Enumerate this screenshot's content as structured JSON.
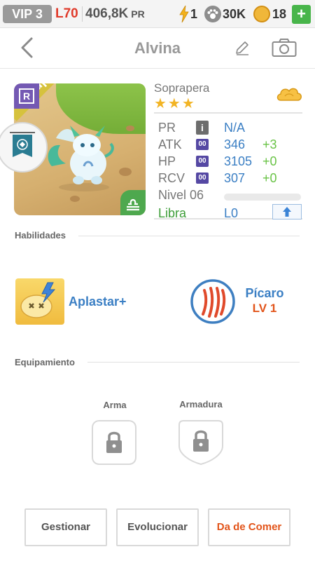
{
  "status_bar": {
    "vip": "VIP 3",
    "player_level": "L70",
    "power_value": "406,8K",
    "power_unit": "PR",
    "energy": "1",
    "food": "30K",
    "coins": "18",
    "add_label": "+"
  },
  "header": {
    "title": "Alvina"
  },
  "monster": {
    "rarity_letter": "R",
    "rarity_ribbon": "Super",
    "species": "Soprapera",
    "stars": "★★★",
    "stats": [
      {
        "label": "PR",
        "tag": "i",
        "value": "N/A",
        "bonus": ""
      },
      {
        "label": "ATK",
        "tag": "00",
        "value": "346",
        "bonus": "+3"
      },
      {
        "label": "HP",
        "tag": "00",
        "value": "3105",
        "bonus": "+0"
      },
      {
        "label": "RCV",
        "tag": "00",
        "value": "307",
        "bonus": "+0"
      }
    ],
    "level_label": "Nivel 06",
    "xp_fraction": 0.0,
    "zodiac": "Libra",
    "zodiac_level": "L0"
  },
  "sections": {
    "abilities": "Habilidades",
    "equipment": "Equipamiento"
  },
  "abilities": {
    "skill_name": "Aplastar+",
    "trait_name": "Pícaro",
    "trait_level": "LV 1"
  },
  "equipment": {
    "weapon_label": "Arma",
    "armor_label": "Armadura"
  },
  "actions": {
    "manage": "Gestionar",
    "evolve": "Evolucionar",
    "feed": "Da de Comer"
  },
  "colors": {
    "accent_blue": "#3b7fc4",
    "bonus_green": "#69c346",
    "player_level_red": "#e03a2a",
    "feed_orange": "#e2541a",
    "rarity_purple": "#7459b3",
    "ribbon_gold": "#d6c23d",
    "star_gold": "#f2b424"
  },
  "icons": {
    "back": "chevron-left-icon",
    "edit": "pencil-icon",
    "camera": "camera-icon",
    "energy": "lightning-icon",
    "food": "paw-icon",
    "coin": "coin-icon",
    "element": "cloud-element-icon",
    "upgrade": "arrow-up-icon",
    "lock": "lock-icon",
    "zodiac": "libra-icon"
  }
}
